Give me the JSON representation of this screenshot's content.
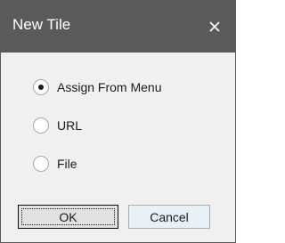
{
  "window": {
    "title": "New Tile",
    "close_icon": "close-icon"
  },
  "options": [
    {
      "label": "Assign From Menu",
      "selected": true
    },
    {
      "label": "URL",
      "selected": false
    },
    {
      "label": "File",
      "selected": false
    }
  ],
  "buttons": {
    "ok_label": "OK",
    "cancel_label": "Cancel"
  },
  "colors": {
    "titlebar": "#5a5a5a",
    "dialog_background": "#f0f0f0"
  }
}
